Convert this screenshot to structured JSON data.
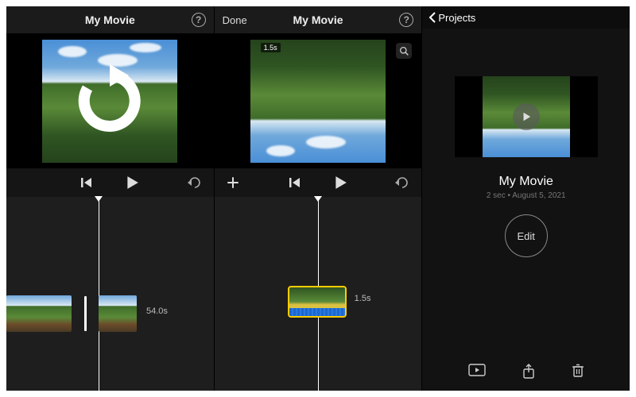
{
  "panel1": {
    "title": "My Movie",
    "help": "?",
    "transport": {
      "skip_back": "skip-back",
      "play": "play",
      "undo": "undo"
    },
    "timeline": {
      "clip_duration_label": "54.0s"
    }
  },
  "panel2": {
    "done": "Done",
    "title": "My Movie",
    "help": "?",
    "preview_duration": "1.5s",
    "transport": {
      "add": "add",
      "skip_back": "skip-back",
      "play": "play",
      "undo": "undo"
    },
    "timeline": {
      "clip_duration_label": "1.5s"
    }
  },
  "panel3": {
    "back_label": "Projects",
    "project_title": "My Movie",
    "project_meta": "2 sec • August 5, 2021",
    "edit_label": "Edit",
    "actions": {
      "play": "play",
      "share": "share",
      "delete": "delete"
    }
  }
}
